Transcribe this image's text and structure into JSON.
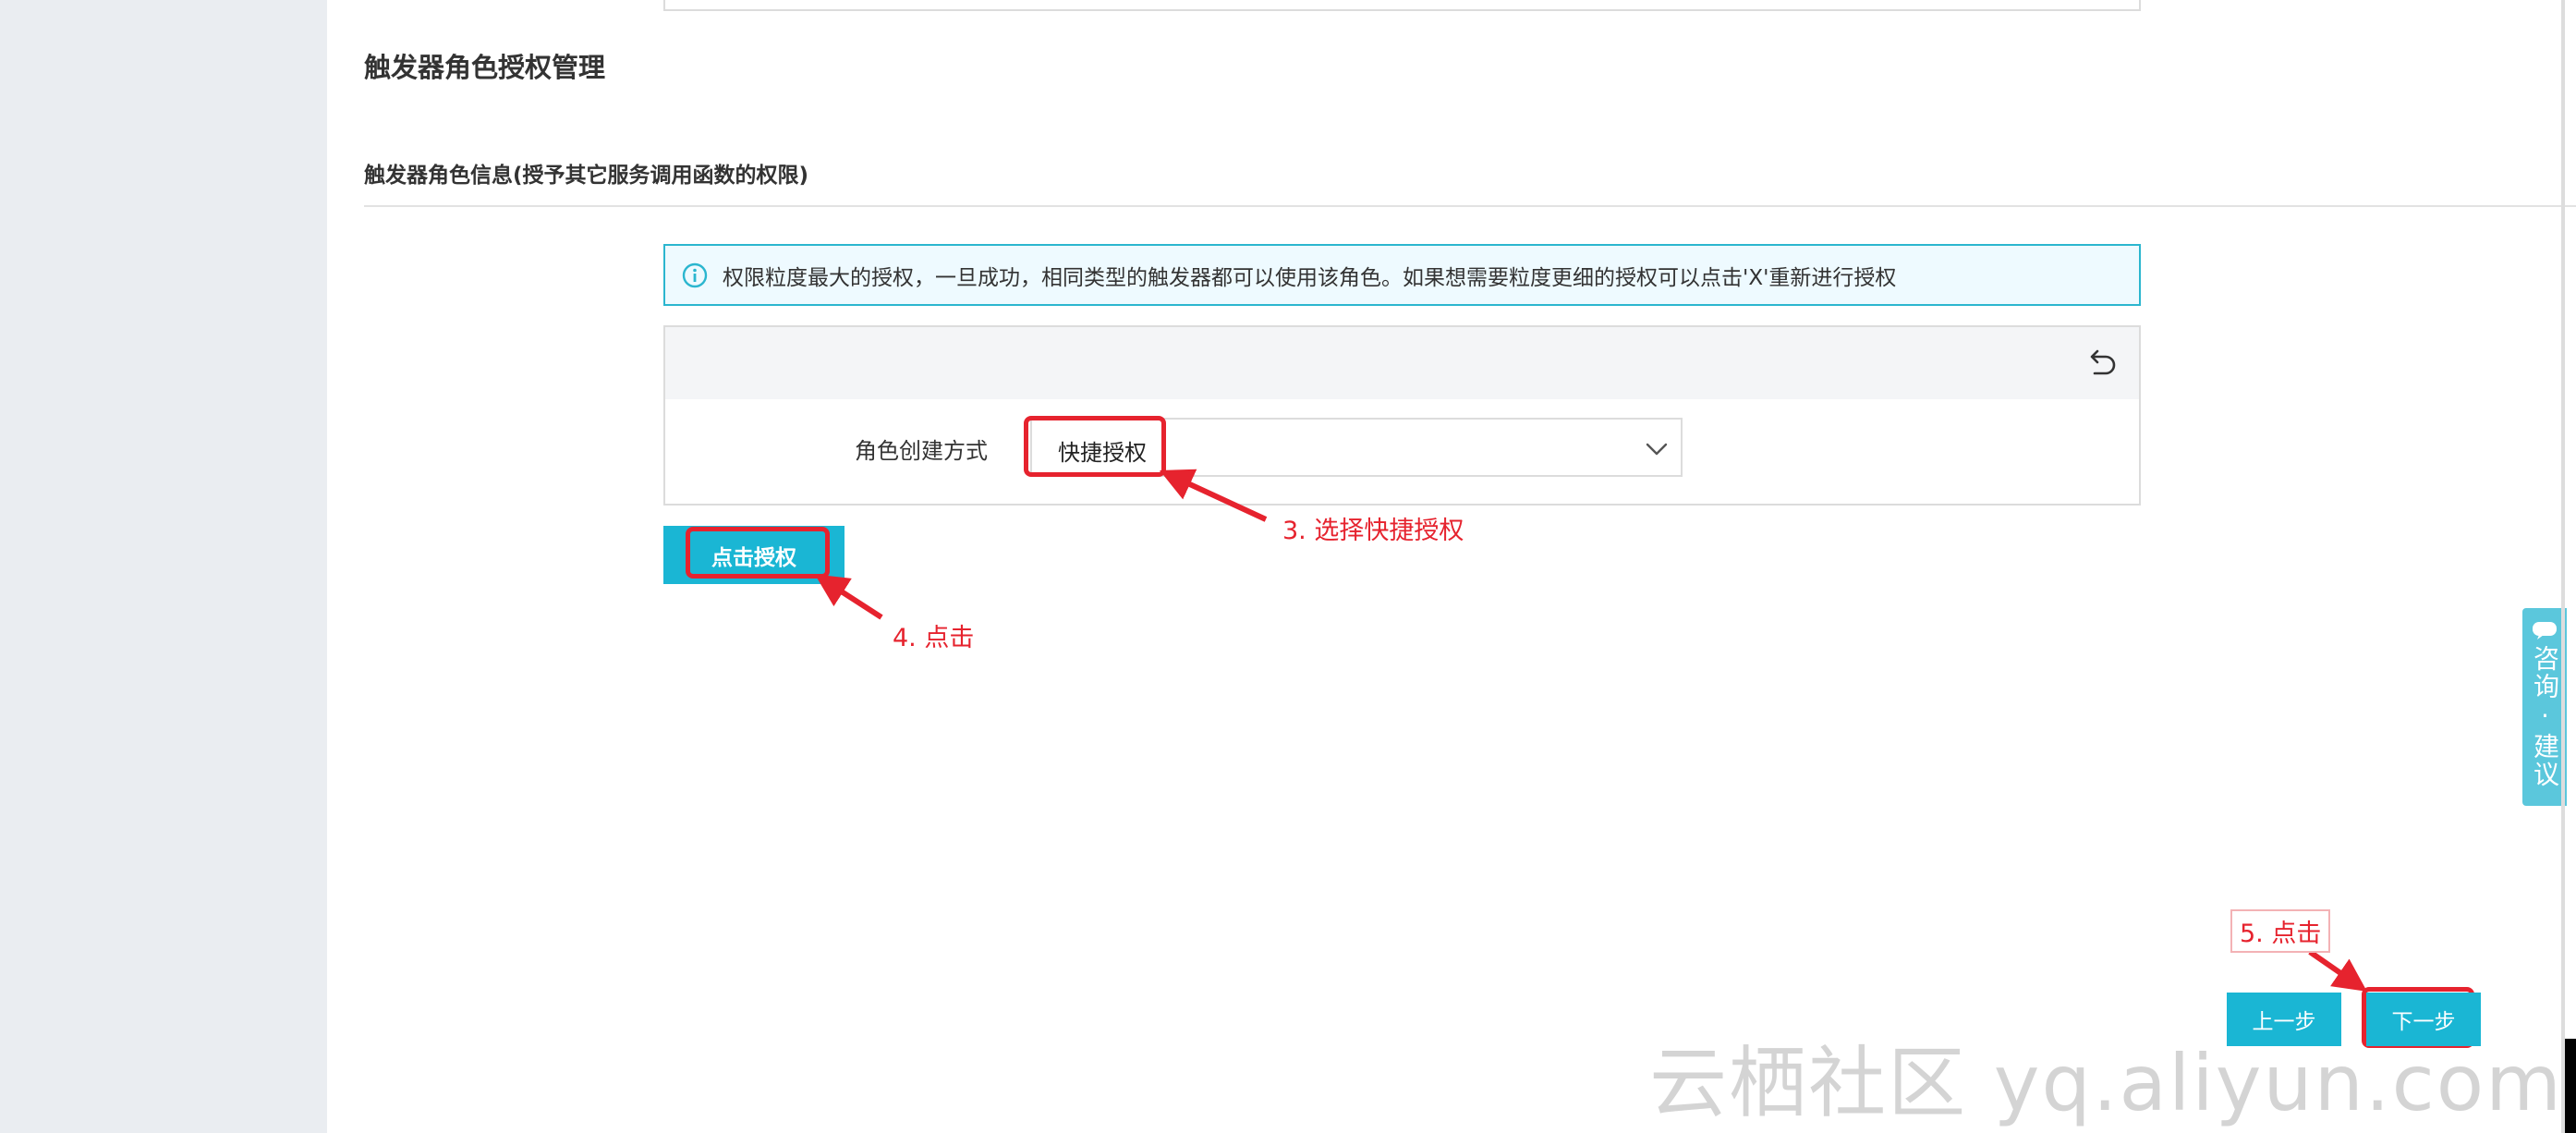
{
  "page": {
    "section_title": "触发器角色授权管理",
    "subsection_title": "触发器角色信息(授予其它服务调用函数的权限)"
  },
  "info_bar": {
    "icon": "info-icon",
    "text": "权限粒度最大的授权，一旦成功，相同类型的触发器都可以使用该角色。如果想需要粒度更细的授权可以点击'X'重新进行授权"
  },
  "form": {
    "reset_icon": "undo-icon",
    "role_creation_label": "角色创建方式",
    "role_creation_value": "快捷授权",
    "authorize_button": "点击授权"
  },
  "annotations": {
    "step3": "3. 选择快捷授权",
    "step4": "4. 点击",
    "step5": "5. 点击"
  },
  "footer": {
    "prev_button": "上一步",
    "next_button": "下一步"
  },
  "feedback": {
    "text": "咨询·建议",
    "icon": "chat-icon"
  },
  "watermark": "云栖社区 yq.aliyun.com",
  "colors": {
    "accent": "#1ab6d4",
    "annotation_red": "#e6232e",
    "info_border": "#2bb6cf",
    "info_bg": "#eefaff"
  }
}
